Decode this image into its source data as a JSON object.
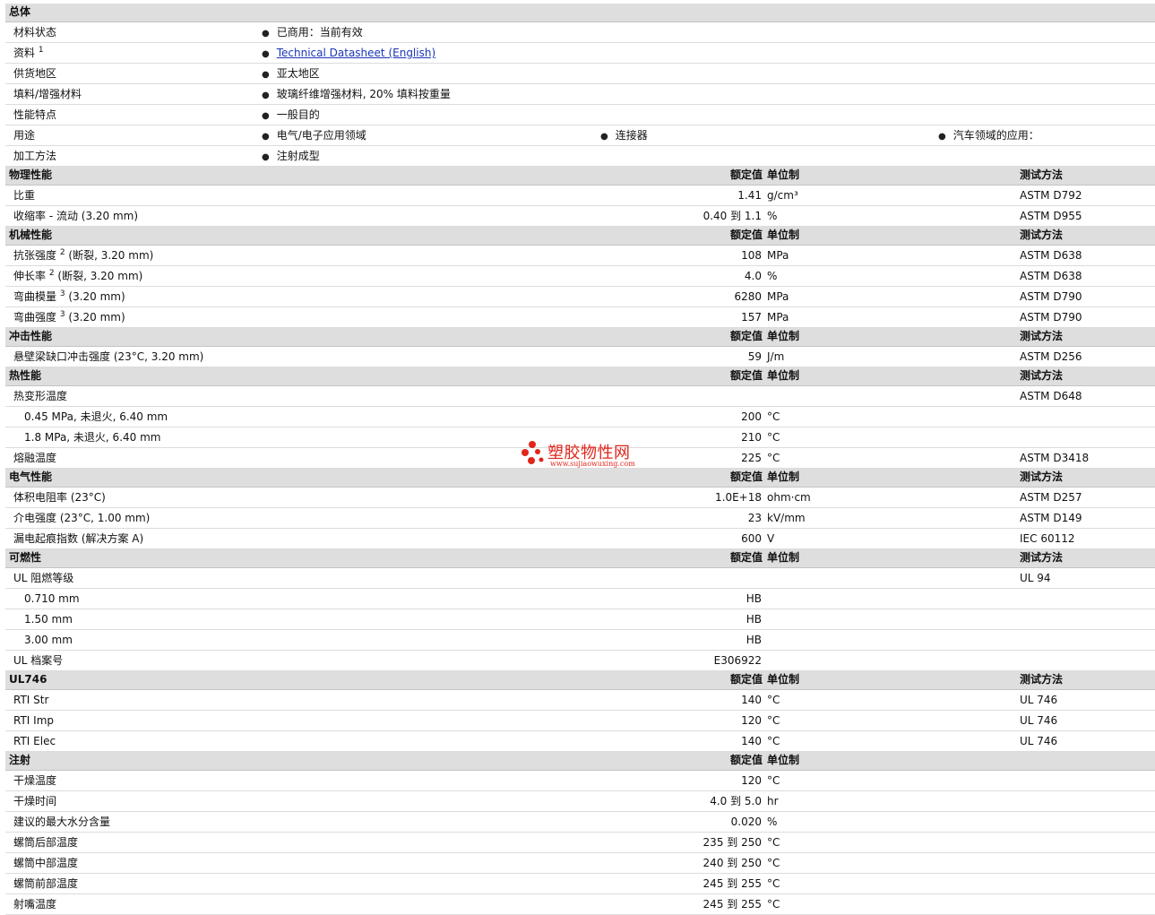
{
  "general": {
    "title": "总体",
    "rows": [
      {
        "label": "材料状态",
        "items": [
          "已商用：当前有效"
        ]
      },
      {
        "label": "资料",
        "sup": "1",
        "link": "Technical Datasheet (English)"
      },
      {
        "label": "供货地区",
        "items": [
          "亚太地区"
        ]
      },
      {
        "label": "填料/增强材料",
        "items": [
          "玻璃纤维增强材料, 20% 填料按重量"
        ]
      },
      {
        "label": "性能特点",
        "items": [
          "一般目的"
        ]
      },
      {
        "label": "用途",
        "items": [
          "电气/电子应用领域",
          "连接器",
          "汽车领域的应用："
        ]
      },
      {
        "label": "加工方法",
        "items": [
          "注射成型"
        ]
      }
    ]
  },
  "col_headers": {
    "nominal": "额定值",
    "unit": "单位制",
    "test": "测试方法"
  },
  "sections": [
    {
      "title": "物理性能",
      "show_test": true,
      "rows": [
        {
          "label": "比重",
          "value": "1.41",
          "unit": "g/cm³",
          "test": "ASTM D792"
        },
        {
          "label": "收缩率 - 流动 (3.20 mm)",
          "value": "0.40 到 1.1",
          "unit": "%",
          "test": "ASTM D955"
        }
      ]
    },
    {
      "title": "机械性能",
      "show_test": true,
      "rows": [
        {
          "label": "抗张强度",
          "sup": "2",
          "suffix": "(断裂, 3.20 mm)",
          "value": "108",
          "unit": "MPa",
          "test": "ASTM D638"
        },
        {
          "label": "伸长率",
          "sup": "2",
          "suffix": "(断裂, 3.20 mm)",
          "value": "4.0",
          "unit": "%",
          "test": "ASTM D638"
        },
        {
          "label": "弯曲模量",
          "sup": "3",
          "suffix": "(3.20 mm)",
          "value": "6280",
          "unit": "MPa",
          "test": "ASTM D790"
        },
        {
          "label": "弯曲强度",
          "sup": "3",
          "suffix": "(3.20 mm)",
          "value": "157",
          "unit": "MPa",
          "test": "ASTM D790"
        }
      ]
    },
    {
      "title": "冲击性能",
      "show_test": true,
      "rows": [
        {
          "label": "悬壁梁缺口冲击强度 (23°C, 3.20 mm)",
          "value": "59",
          "unit": "J/m",
          "test": "ASTM D256"
        }
      ]
    },
    {
      "title": "热性能",
      "show_test": true,
      "rows": [
        {
          "label": "热变形温度",
          "value": "",
          "unit": "",
          "test": "ASTM D648"
        },
        {
          "label": "0.45 MPa, 未退火, 6.40 mm",
          "sub": true,
          "value": "200",
          "unit": "°C",
          "test": ""
        },
        {
          "label": "1.8 MPa, 未退火, 6.40 mm",
          "sub": true,
          "value": "210",
          "unit": "°C",
          "test": ""
        },
        {
          "label": "熔融温度",
          "value": "225",
          "unit": "°C",
          "test": "ASTM D3418"
        }
      ]
    },
    {
      "title": "电气性能",
      "show_test": true,
      "rows": [
        {
          "label": "体积电阻率 (23°C)",
          "value": "1.0E+18",
          "unit": "ohm·cm",
          "test": "ASTM D257"
        },
        {
          "label": "介电强度 (23°C, 1.00 mm)",
          "value": "23",
          "unit": "kV/mm",
          "test": "ASTM D149"
        },
        {
          "label": "漏电起痕指数 (解决方案 A)",
          "value": "600",
          "unit": "V",
          "test": "IEC 60112"
        }
      ]
    },
    {
      "title": "可燃性",
      "show_test": true,
      "rows": [
        {
          "label": "UL 阻燃等级",
          "value": "",
          "unit": "",
          "test": "UL 94"
        },
        {
          "label": "0.710 mm",
          "sub": true,
          "value": "HB",
          "unit": "",
          "test": ""
        },
        {
          "label": "1.50 mm",
          "sub": true,
          "value": "HB",
          "unit": "",
          "test": ""
        },
        {
          "label": "3.00 mm",
          "sub": true,
          "value": "HB",
          "unit": "",
          "test": ""
        },
        {
          "label": "UL 档案号",
          "value": "E306922",
          "unit": "",
          "test": ""
        }
      ]
    },
    {
      "title": "UL746",
      "show_test": true,
      "rows": [
        {
          "label": "RTI Str",
          "value": "140",
          "unit": "°C",
          "test": "UL 746"
        },
        {
          "label": "RTI Imp",
          "value": "120",
          "unit": "°C",
          "test": "UL 746"
        },
        {
          "label": "RTI Elec",
          "value": "140",
          "unit": "°C",
          "test": "UL 746"
        }
      ]
    },
    {
      "title": "注射",
      "show_test": false,
      "rows": [
        {
          "label": "干燥温度",
          "value": "120",
          "unit": "°C",
          "test": ""
        },
        {
          "label": "干燥时间",
          "value": "4.0 到 5.0",
          "unit": "hr",
          "test": ""
        },
        {
          "label": "建议的最大水分含量",
          "value": "0.020",
          "unit": "%",
          "test": ""
        },
        {
          "label": "螺筒后部温度",
          "value": "235 到 250",
          "unit": "°C",
          "test": ""
        },
        {
          "label": "螺筒中部温度",
          "value": "240 到 250",
          "unit": "°C",
          "test": ""
        },
        {
          "label": "螺筒前部温度",
          "value": "245 到 255",
          "unit": "°C",
          "test": ""
        },
        {
          "label": "射嘴温度",
          "value": "245 到 255",
          "unit": "°C",
          "test": ""
        }
      ]
    }
  ],
  "watermark": {
    "title": "塑胶物性网",
    "url": "www.sujiaowuxing.com"
  }
}
